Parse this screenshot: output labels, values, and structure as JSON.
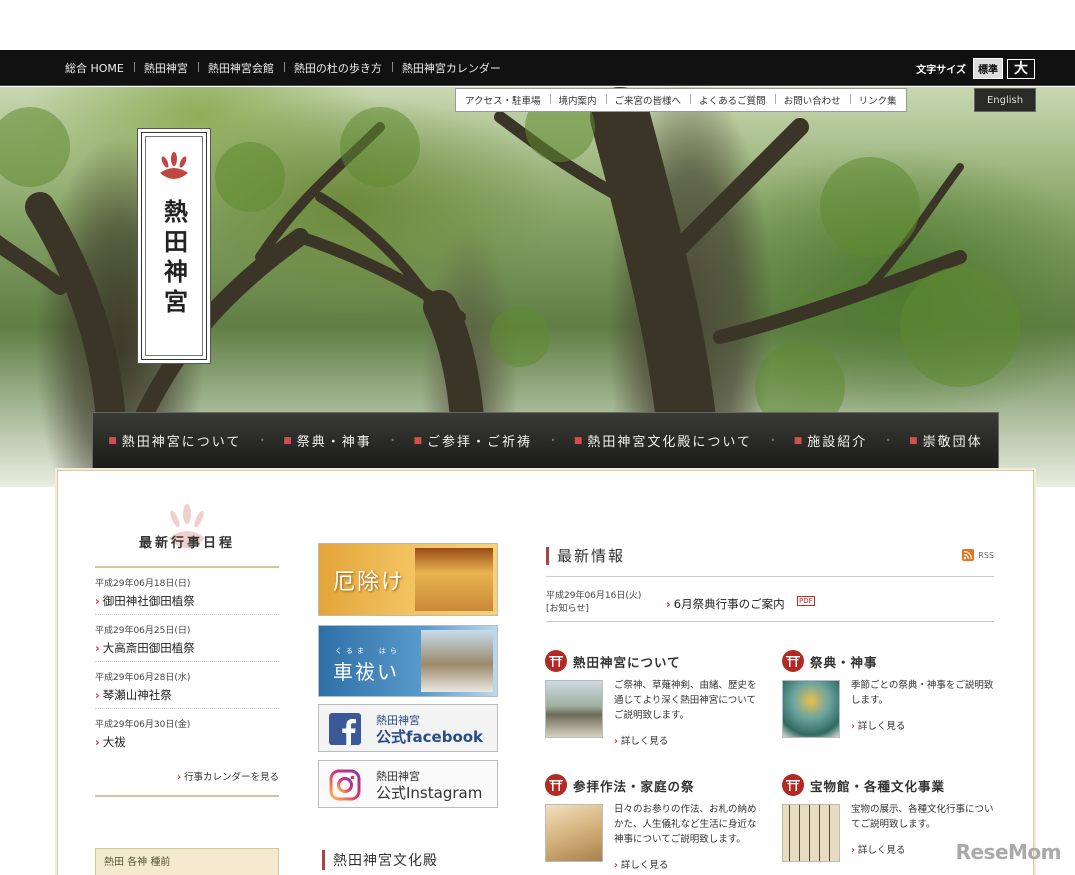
{
  "top_nav": [
    "総合 HOME",
    "熱田神宮",
    "熱田神宮会館",
    "熱田の杜の歩き方",
    "熱田神宮カレンダー"
  ],
  "font_size": {
    "label": "文字サイズ",
    "standard": "標準",
    "large": "大"
  },
  "sub_nav": [
    "アクセス・駐車場",
    "境内案内",
    "ご来宮の皆様へ",
    "よくあるご質問",
    "お問い合わせ",
    "リンク集"
  ],
  "english_label": "English",
  "logo_text": "熱田神宮",
  "main_nav": [
    "熱田神宮について",
    "祭典・神事",
    "ご参拝・ご祈祷",
    "熱田神宮文化殿について",
    "施設紹介",
    "崇敬団体"
  ],
  "events": {
    "heading": "最新行事日程",
    "items": [
      {
        "date": "平成29年06月18日(日)",
        "title": "御田神社御田植祭"
      },
      {
        "date": "平成29年06月25日(日)",
        "title": "大高斎田御田植祭"
      },
      {
        "date": "平成29年06月28日(水)",
        "title": "琴瀬山神社祭"
      },
      {
        "date": "平成29年06月30日(金)",
        "title": "大祓"
      }
    ],
    "calendar_link": "行事カレンダーを見る"
  },
  "bottom_thumb_text": "熱田 各神 種前",
  "banners": {
    "yakuyoke": "厄除け",
    "kurumabarai_ruby": "くるま　はら",
    "kurumabarai": "車祓い",
    "facebook_small": "熱田神宮",
    "facebook_big": "公式facebook",
    "instagram_small": "熱田神宮",
    "instagram_big": "公式Instagram"
  },
  "bunka_heading": "熱田神宮文化殿",
  "news": {
    "heading": "最新情報",
    "rss": "RSS",
    "items": [
      {
        "date": "平成29年06月16日(火)",
        "category": "[お知らせ]",
        "title": "6月祭典行事のご案内",
        "badge": "PDF"
      }
    ]
  },
  "sections": [
    {
      "title": "熱田神宮について",
      "desc": "ご祭神、草薙神剣、由緒、歴史を通じてより深く熱田神宮についてご説明致します。",
      "more": "詳しく見る"
    },
    {
      "title": "祭典・神事",
      "desc": "季節ごとの祭典・神事をご説明致します。",
      "more": "詳しく見る"
    },
    {
      "title": "参拝作法・家庭の祭",
      "desc": "日々のお参りの作法、お札の納めかた、人生儀礼など生活に身近な神事についてご説明致します。",
      "more": "詳しく見る"
    },
    {
      "title": "宝物館・各種文化事業",
      "desc": "宝物の展示、各種文化行事についてご説明致します。",
      "more": "詳しく見る"
    }
  ],
  "watermark": "ReseMom",
  "colors": {
    "accent_red": "#b12a23",
    "nav_black": "#111111",
    "gold_rule": "#d7c49a"
  }
}
